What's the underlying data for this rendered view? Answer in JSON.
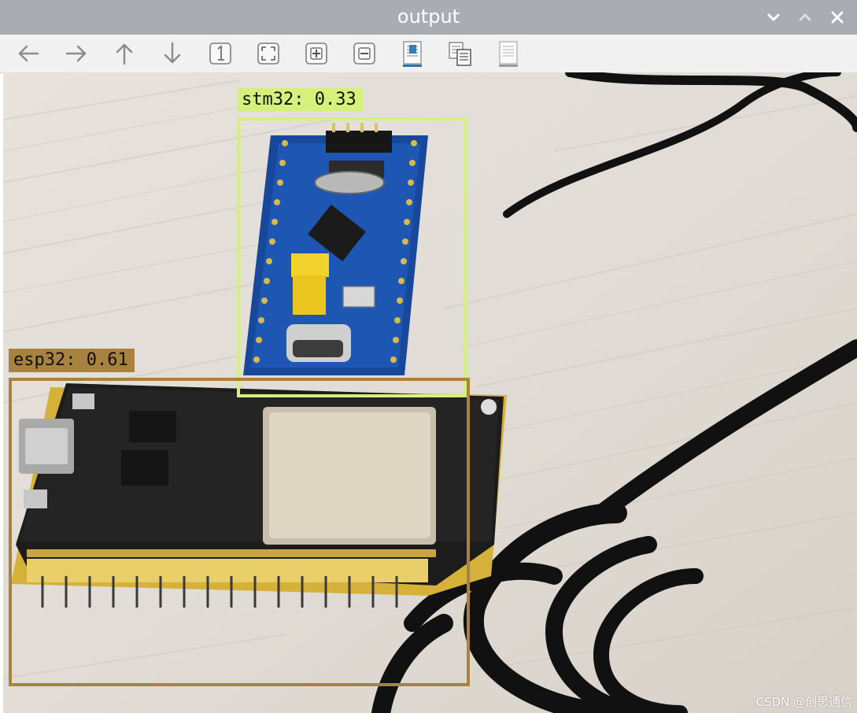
{
  "window": {
    "title": "output",
    "controls": [
      "minimize",
      "maximize",
      "close"
    ]
  },
  "toolbar": {
    "buttons": [
      {
        "name": "back",
        "icon": "arrow-left-icon"
      },
      {
        "name": "forward",
        "icon": "arrow-right-icon"
      },
      {
        "name": "up",
        "icon": "arrow-up-icon"
      },
      {
        "name": "down",
        "icon": "arrow-down-icon"
      },
      {
        "name": "zoom-original",
        "icon": "zoom-1-icon"
      },
      {
        "name": "fit-to-window",
        "icon": "fit-window-icon"
      },
      {
        "name": "zoom-in",
        "icon": "zoom-plus-icon"
      },
      {
        "name": "zoom-out",
        "icon": "zoom-minus-icon"
      },
      {
        "name": "save",
        "icon": "save-icon"
      },
      {
        "name": "copy",
        "icon": "copy-icon"
      },
      {
        "name": "properties",
        "icon": "document-icon"
      }
    ]
  },
  "detections": [
    {
      "label": "stm32: 0.33",
      "color": "#d6f07c"
    },
    {
      "label": "esp32: 0.61",
      "color": "#a8823f"
    }
  ],
  "watermark": "CSDN @创思通信"
}
